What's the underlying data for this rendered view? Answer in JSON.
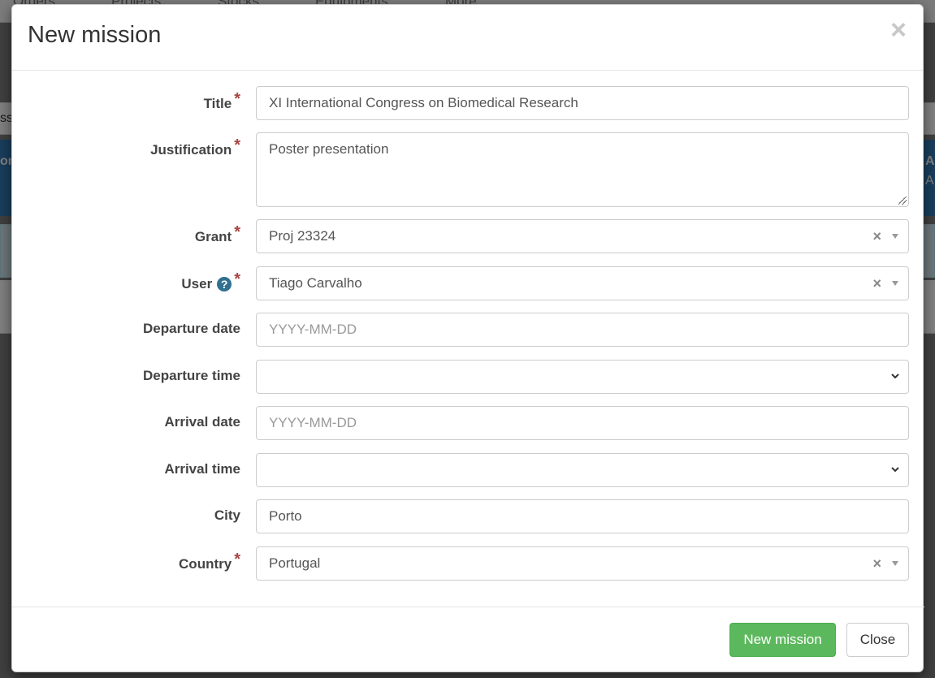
{
  "background": {
    "nav": [
      "Orders",
      "Projects",
      "Stocks",
      "Equipments",
      "More"
    ],
    "crumb": "ssi",
    "left_fragment": "on",
    "right_fragment_1": "A",
    "right_fragment_2": "A"
  },
  "modal": {
    "title": "New mission",
    "close_glyph": "×"
  },
  "form": {
    "title": {
      "label": "Title",
      "value": "XI International Congress on Biomedical Research"
    },
    "justification": {
      "label": "Justification",
      "value": "Poster presentation"
    },
    "grant": {
      "label": "Grant",
      "value": "Proj 23324"
    },
    "user": {
      "label": "User",
      "value": "Tiago Carvalho"
    },
    "departure_date": {
      "label": "Departure date",
      "placeholder": "YYYY-MM-DD"
    },
    "departure_time": {
      "label": "Departure time",
      "value": ""
    },
    "arrival_date": {
      "label": "Arrival date",
      "placeholder": "YYYY-MM-DD"
    },
    "arrival_time": {
      "label": "Arrival time",
      "value": ""
    },
    "city": {
      "label": "City",
      "value": "Porto"
    },
    "country": {
      "label": "Country",
      "value": "Portugal"
    },
    "required_mark": "*",
    "help_glyph": "?",
    "clear_glyph": "×"
  },
  "footer": {
    "submit_label": "New mission",
    "close_label": "Close"
  },
  "colors": {
    "primary_success": "#5cb85c",
    "required": "#a94442",
    "help_icon": "#31708f"
  }
}
